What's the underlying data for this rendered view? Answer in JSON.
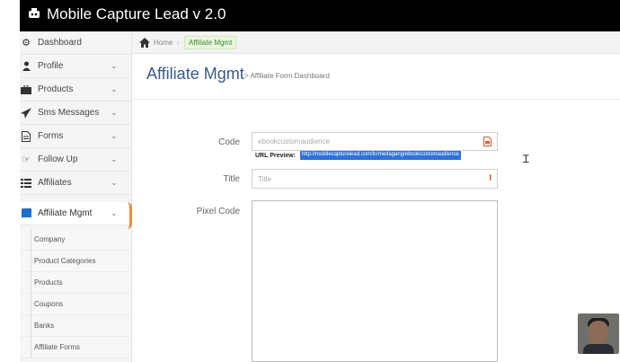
{
  "app": {
    "title": "Mobile Capture Lead v 2.0"
  },
  "sidebar": {
    "items": [
      {
        "label": "Dashboard",
        "icon": "dashboard-icon",
        "chevron": false
      },
      {
        "label": "Profile",
        "icon": "user-icon",
        "chevron": true
      },
      {
        "label": "Products",
        "icon": "briefcase-icon",
        "chevron": true
      },
      {
        "label": "Sms Messages",
        "icon": "send-icon",
        "chevron": true
      },
      {
        "label": "Forms",
        "icon": "document-icon",
        "chevron": true
      },
      {
        "label": "Follow Up",
        "icon": "hand-pointer-icon",
        "chevron": true
      },
      {
        "label": "Affiliates",
        "icon": "list-icon",
        "chevron": true
      },
      {
        "label": "Affiliate Mgmt",
        "icon": "book-icon",
        "chevron": true,
        "active": true
      }
    ],
    "subitems": [
      {
        "label": "Company"
      },
      {
        "label": "Product Categories"
      },
      {
        "label": "Products"
      },
      {
        "label": "Coupons"
      },
      {
        "label": "Banks"
      },
      {
        "label": "Affiliate Forms"
      }
    ]
  },
  "breadcrumb": {
    "home": "Home",
    "separator": "›",
    "current": "Affiliate Mgmt"
  },
  "page": {
    "title": "Affiliate Mgmt",
    "subtitle": "> Affiliate Form Dashboard"
  },
  "form": {
    "code_label": "Code",
    "code_value": "ebookcustomaudience",
    "url_preview_label": "URL Preview:",
    "url_preview_value": "http://mobilecapturelead.com/lc/medagang/ebookcustomaudience",
    "title_label": "Title",
    "title_placeholder": "Title",
    "pixel_label": "Pixel Code"
  },
  "colors": {
    "accent": "#f08a3c",
    "title_blue": "#3b5a8a",
    "selection": "#2f71d8"
  }
}
